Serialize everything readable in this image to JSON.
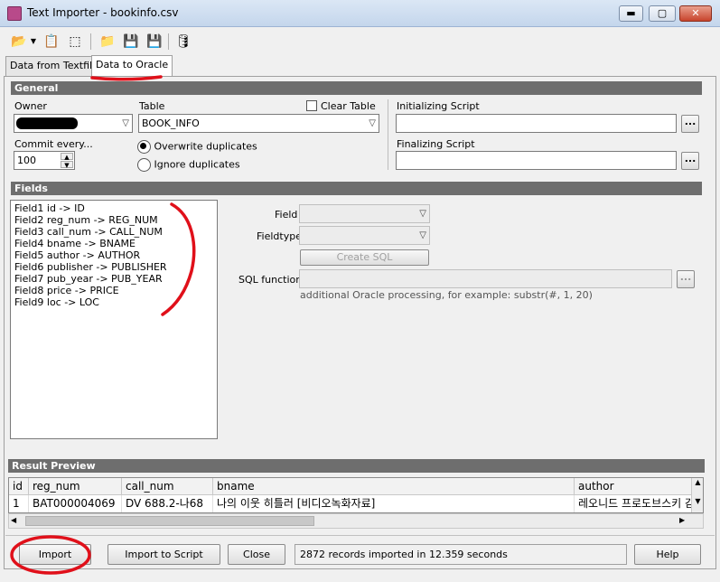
{
  "window": {
    "title": "Text Importer - bookinfo.csv",
    "minimize_label": "▬",
    "maximize_label": "▢",
    "close_label": "✕"
  },
  "tabs": [
    {
      "label": "Data from Textfile",
      "active": false
    },
    {
      "label": "Data to Oracle",
      "active": true
    }
  ],
  "general": {
    "header": "General",
    "owner_label": "Owner",
    "owner_value": "",
    "table_label": "Table",
    "table_value": "BOOK_INFO",
    "clear_table_label": "Clear Table",
    "init_script_label": "Initializing Script",
    "init_script_value": "",
    "final_script_label": "Finalizing Script",
    "final_script_value": "",
    "commit_label": "Commit every...",
    "commit_value": "100",
    "overwrite_label": "Overwrite duplicates",
    "ignore_label": "Ignore duplicates",
    "ellipsis": "..."
  },
  "fields": {
    "header": "Fields",
    "items": [
      "Field1  id  ->  ID",
      "Field2  reg_num  ->  REG_NUM",
      "Field3  call_num  ->  CALL_NUM",
      "Field4  bname  ->  BNAME",
      "Field5  author  ->  AUTHOR",
      "Field6  publisher  ->  PUBLISHER",
      "Field7  pub_year  ->  PUB_YEAR",
      "Field8  price  ->  PRICE",
      "Field9  loc  ->  LOC"
    ],
    "field_label": "Field",
    "fieldtype_label": "Fieldtype",
    "create_sql_label": "Create SQL",
    "sql_function_label": "SQL function",
    "sql_hint": "additional Oracle processing, for example: substr(#, 1, 20)"
  },
  "preview": {
    "header": "Result Preview",
    "columns": [
      "id",
      "reg_num",
      "call_num",
      "bname",
      "author"
    ],
    "row": [
      "1",
      "BAT000004069",
      "DV 688.2-나68",
      "나의 이웃 히틀러 [비디오녹화자료]",
      "레오니드 프로도브스키 감"
    ]
  },
  "buttons": {
    "import": "Import",
    "import_to_script": "Import to Script",
    "close": "Close",
    "help": "Help"
  },
  "status": "2872 records imported in 12.359 seconds",
  "colors": {
    "annotation_red": "#e0101a",
    "section_header": "#6e6e6e"
  }
}
